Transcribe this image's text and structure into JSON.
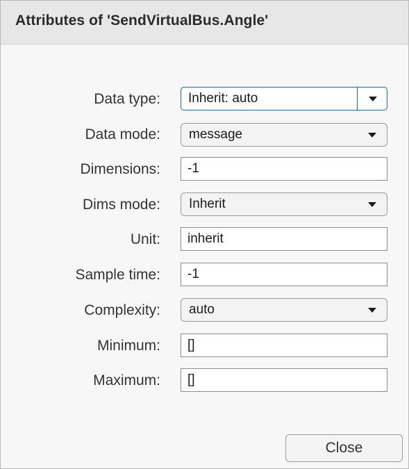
{
  "dialog": {
    "title": "Attributes of 'SendVirtualBus.Angle'"
  },
  "fields": {
    "data_type": {
      "label": "Data type:",
      "value": "Inherit: auto"
    },
    "data_mode": {
      "label": "Data mode:",
      "value": "message"
    },
    "dimensions": {
      "label": "Dimensions:",
      "value": "-1"
    },
    "dims_mode": {
      "label": "Dims mode:",
      "value": "Inherit"
    },
    "unit": {
      "label": "Unit:",
      "value": "inherit"
    },
    "sample_time": {
      "label": "Sample time:",
      "value": "-1"
    },
    "complexity": {
      "label": "Complexity:",
      "value": "auto"
    },
    "minimum": {
      "label": "Minimum:",
      "value": "[]"
    },
    "maximum": {
      "label": "Maximum:",
      "value": "[]"
    }
  },
  "buttons": {
    "close_label": "Close"
  },
  "icons": {
    "dropdown": "chevron-down-icon"
  },
  "colors": {
    "focus_border": "#0e72c4",
    "titlebar_bg": "#e7e7e7"
  }
}
